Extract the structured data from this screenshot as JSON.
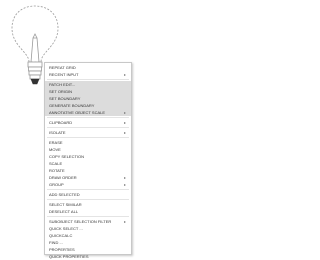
{
  "menu": {
    "items": [
      {
        "label": "REPEAT GRID",
        "highlighted": false,
        "submenu": false
      },
      {
        "label": "RECENT INPUT",
        "highlighted": false,
        "submenu": true
      },
      {
        "label": "SEP"
      },
      {
        "label": "PATCH EDIT...",
        "highlighted": true,
        "submenu": false
      },
      {
        "label": "SET ORIGIN",
        "highlighted": true,
        "submenu": false
      },
      {
        "label": "SET BOUNDARY",
        "highlighted": true,
        "submenu": false
      },
      {
        "label": "GENERATE BOUNDARY",
        "highlighted": true,
        "submenu": false
      },
      {
        "label": "ANNOTATIVE OBJECT SCALE",
        "highlighted": true,
        "submenu": true
      },
      {
        "label": "SEP"
      },
      {
        "label": "CLIPBOARD",
        "highlighted": false,
        "submenu": true
      },
      {
        "label": "SEP"
      },
      {
        "label": "ISOLATE",
        "highlighted": false,
        "submenu": true
      },
      {
        "label": "SEP"
      },
      {
        "label": "ERASE",
        "highlighted": false,
        "submenu": false
      },
      {
        "label": "MOVE",
        "highlighted": false,
        "submenu": false
      },
      {
        "label": "COPY SELECTION",
        "highlighted": false,
        "submenu": false
      },
      {
        "label": "SCALE",
        "highlighted": false,
        "submenu": false
      },
      {
        "label": "ROTATE",
        "highlighted": false,
        "submenu": false
      },
      {
        "label": "DRAW ORDER",
        "highlighted": false,
        "submenu": true
      },
      {
        "label": "GROUP",
        "highlighted": false,
        "submenu": true
      },
      {
        "label": "SEP"
      },
      {
        "label": "ADD SELECTED",
        "highlighted": false,
        "submenu": false
      },
      {
        "label": "SEP"
      },
      {
        "label": "SELECT SIMILAR",
        "highlighted": false,
        "submenu": false
      },
      {
        "label": "DESELECT ALL",
        "highlighted": false,
        "submenu": false
      },
      {
        "label": "SEP"
      },
      {
        "label": "SUBOBJECT SELECTION FILTER",
        "highlighted": false,
        "submenu": true
      },
      {
        "label": "QUICK SELECT ...",
        "highlighted": false,
        "submenu": false
      },
      {
        "label": "QUICKCALC",
        "highlighted": false,
        "submenu": false
      },
      {
        "label": "FIND ...",
        "highlighted": false,
        "submenu": false
      },
      {
        "label": "PROPERTIES",
        "highlighted": false,
        "submenu": false
      },
      {
        "label": "QUICK PROPERTIES",
        "highlighted": false,
        "submenu": false
      }
    ],
    "arrow_glyph": "▸"
  }
}
